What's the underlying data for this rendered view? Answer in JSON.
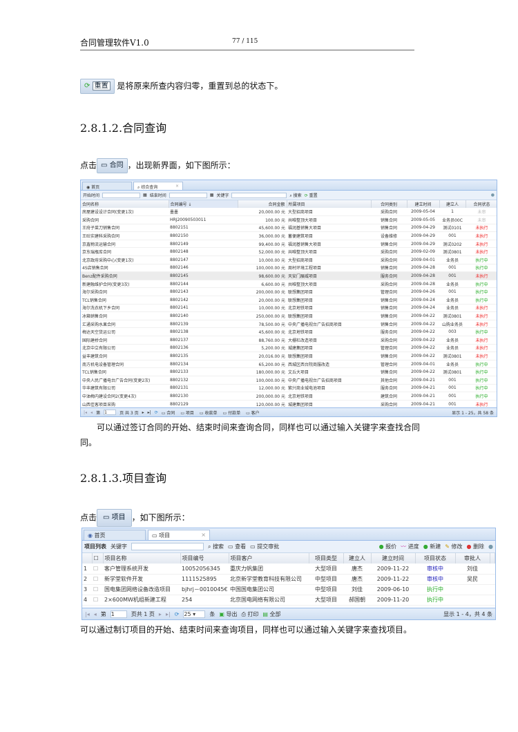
{
  "header": {
    "title": "合同管理软件V1.0",
    "page": "77 / 115"
  },
  "reset_para": {
    "button": "重置",
    "text": "是将原来所查内容归零，重置到总的状态下。"
  },
  "section1": {
    "heading": "2.8.1.2.合同查询",
    "click_prefix": "点击",
    "button": "合同",
    "click_suffix": "，出现新界面，如下图所示：",
    "desc_line1": "可以通过签订合同的开始、结束时间来查询合同，同样也可以通过输入关键字来查找合同",
    "desc_line2": "同。"
  },
  "contract_grid": {
    "tabs": [
      "首页",
      "综合查询"
    ],
    "toolbar": {
      "start": "开始时间",
      "end": "结束时间",
      "keyword": "关键字",
      "search": "搜索",
      "reset": "重置"
    },
    "columns": [
      "合同名称",
      "合同编号 ↓",
      "合同金额",
      "所属项目",
      "合同类别",
      "建立时间",
      "建立人",
      "合同状态"
    ],
    "rows": [
      [
        "房屋建设设计合同(变更1次)",
        "墨墨",
        "20,000.00 元",
        "大型招商项目",
        "采购合同",
        "2009-05-04",
        "1",
        "未审"
      ],
      [
        "采购合同",
        "HRJ20090503011",
        "100.00 元",
        "共唯整顶大项目",
        "销售合同",
        "2009-05-05",
        "业务员00C",
        "未审"
      ],
      [
        "王府子菜刀销售合同",
        "8802151",
        "45,600.00 元",
        "福润基销售大项目",
        "销售合同",
        "2009-04-29",
        "测试0101",
        "未执行"
      ],
      [
        "王砼实建科采购合同",
        "8802150",
        "36,000.00 元",
        "蓄便建筑项目",
        "设备维修",
        "2009-04-29",
        "001",
        "未执行"
      ],
      [
        "京鑫物流运输合同",
        "8802149",
        "99,400.00 元",
        "福润基销售大项目",
        "销售合同",
        "2009-04-29",
        "测试0202",
        "未执行"
      ],
      [
        "京东瑞瓶库合同",
        "8802148",
        "52,000.00 元",
        "共唯整顶大项目",
        "采购合同",
        "2009-02-09",
        "测试0801",
        "未执行"
      ],
      [
        "北京政府采购中心(变更1次)",
        "8802147",
        "10,000.00 元",
        "大型招商项目",
        "采购合同",
        "2009-04-01",
        "业务员",
        "执行中"
      ],
      [
        "4S店销售合同",
        "8802146",
        "100,000.00 元",
        "周村环境工程项目",
        "销售合同",
        "2009-04-28",
        "001",
        "执行中"
      ],
      [
        "Benz配件采购合同",
        "8802145",
        "98,600.00 元",
        "天安门展威项目",
        "服务合同",
        "2009-04-28",
        "001",
        "未执行"
      ],
      [
        "新建融维护合同(变更3次)",
        "8802144",
        "6,600.00 元",
        "共唯整顶大项目",
        "采购合同",
        "2009-04-28",
        "业务员",
        "执行中"
      ],
      [
        "海尔采购合同",
        "8802143",
        "200,000.00 元",
        "联想集团项目",
        "管理合同",
        "2009-04-26",
        "001",
        "执行中"
      ],
      [
        "TCL销售合同",
        "8802142",
        "20,000.00 元",
        "联想集团项目",
        "销售合同",
        "2009-04-24",
        "业务员",
        "执行中"
      ],
      [
        "海尔洗衣机下乡合同",
        "8802141",
        "10,000.00 元",
        "北京地铁项目",
        "销售合同",
        "2009-04-24",
        "业务员",
        "未执行"
      ],
      [
        "冰箱销售合同",
        "8802140",
        "250,000.00 元",
        "联想集团项目",
        "销售合同",
        "2009-04-22",
        "测试0801",
        "未执行"
      ],
      [
        "汇通采购水果合同",
        "8802139",
        "78,500.00 元",
        "中央广播电视台广告招商项目",
        "销售合同",
        "2009-04-22",
        "山购业务员",
        "未执行"
      ],
      [
        "梅达天空货运公司",
        "8802138",
        "45,600.00 元",
        "北京地铁项目",
        "服务合同",
        "2009-04-22",
        "003",
        "执行中"
      ],
      [
        "国际建桥合同",
        "8802137",
        "88,760.00 元",
        "大栅栏改造项目",
        "采购合同",
        "2009-04-22",
        "业务员",
        "未执行"
      ],
      [
        "北京中立有限公司",
        "8802136",
        "5,200.00 元",
        "城建集团项目",
        "管理合同",
        "2009-04-22",
        "业务员",
        "未执行"
      ],
      [
        "益丰建筑合同",
        "8802135",
        "20,016.00 元",
        "联想集团项目",
        "销售合同",
        "2009-04-22",
        "测试0801",
        "未执行"
      ],
      [
        "南方机电设备管理合同",
        "8802134",
        "65,200.00 元",
        "西城区西台院商服改造",
        "管理合同",
        "2009-04-01",
        "业务员",
        "执行中"
      ],
      [
        "TCL销售合同",
        "8802133",
        "180,000.00 元",
        "文丘大项目",
        "销售合同",
        "2009-04-22",
        "测试0801",
        "执行中"
      ],
      [
        "中央人民广播电台广告合同(变更2次)",
        "8802132",
        "100,000.00 元",
        "中央广播电视台广告招商项目",
        "其他合同",
        "2009-04-21",
        "001",
        "执行中"
      ],
      [
        "华丰建筑有限公司",
        "8802131",
        "12,000.00 元",
        "紫兴商业城电池项目",
        "服务合同",
        "2009-04-21",
        "001",
        "执行中"
      ],
      [
        "中油梅内建设合同2(变更4次)",
        "8802130",
        "200,000.00 元",
        "北京地铁项目",
        "建筑合同",
        "2009-04-21",
        "001",
        "执行中"
      ],
      [
        "山西佳客项目采购",
        "8802129",
        "120,000.00 元",
        "城建集团项目",
        "采购合同",
        "2009-04-21",
        "001",
        "未执行"
      ]
    ],
    "footer": {
      "page_prefix": "第",
      "page": "1",
      "page_suffix": "页 共 3 页",
      "buttons": [
        "合同",
        "项目",
        "收款单",
        "付款单",
        "客户"
      ],
      "summary": "显示 1 - 25，共 58 条"
    }
  },
  "section2": {
    "heading": "2.8.1.3.项目查询",
    "click_prefix": "点击",
    "button": "项目",
    "click_suffix": "，如下图所示：",
    "desc": "可以通过制订项目的开始、结束时间来查询项目，同样也可以通过输入关键字来查找项目。"
  },
  "project_grid": {
    "tabs": [
      "首页",
      "项目"
    ],
    "toolbar": {
      "list": "项目列表",
      "keyword": "关键字",
      "search": "搜索",
      "view": "查看",
      "submit": "提交审批",
      "quote": "报价",
      "progress": "进度",
      "new": "新建",
      "edit": "修改",
      "delete": "删除"
    },
    "columns": [
      "项目名称",
      "项目编号",
      "项目客户",
      "项目类型",
      "建立人",
      "建立时间",
      "项目状态",
      "审批人"
    ],
    "rows": [
      [
        "1",
        "客户管理系统开发",
        "10052056345",
        "重庆力帆集团",
        "大型项目",
        "唐杰",
        "2009-11-22",
        "审核中",
        "刘佳"
      ],
      [
        "2",
        "新学堂软件开发",
        "1111525895",
        "北京新学堂教育科技有限公司",
        "中型项目",
        "唐杰",
        "2009-11-22",
        "审核中",
        "吴民"
      ],
      [
        "3",
        "国电集团网络设备改造项目",
        "bjhrj－0010045€",
        "中国国电集团公司",
        "中型项目",
        "刘佳",
        "2009-06-10",
        "执行中",
        ""
      ],
      [
        "4",
        "2×600MW机组新建工程",
        "254",
        "北京国电网络有限公司",
        "大型项目",
        "郝国朝",
        "2009-11-20",
        "执行中",
        ""
      ]
    ],
    "footer": {
      "page_prefix": "第",
      "page": "1",
      "page_suffix": "页共 1 页",
      "page_size": "25",
      "per": "条",
      "export": "导出",
      "print": "打印",
      "all": "全部",
      "summary": "显示 1 - 4，共 4 条"
    }
  }
}
